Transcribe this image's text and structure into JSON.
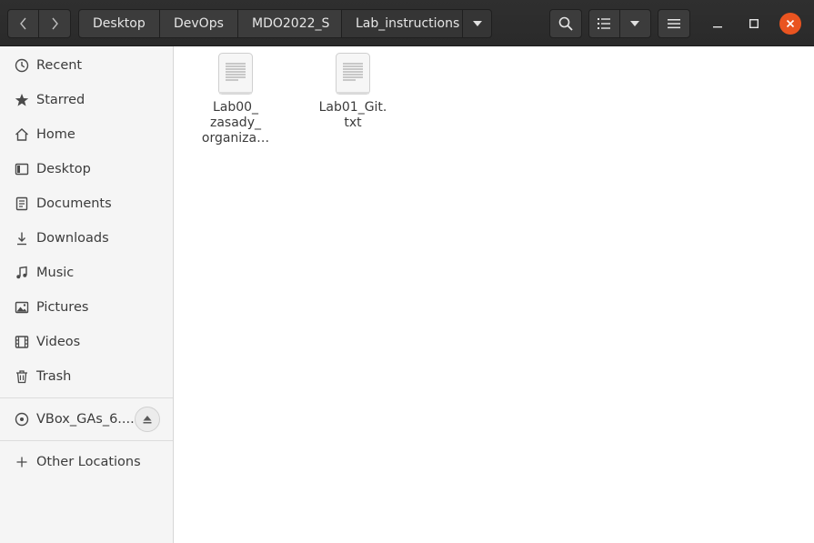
{
  "header": {
    "back_icon": "chevron-left-icon",
    "forward_icon": "chevron-right-icon",
    "breadcrumbs": [
      "Desktop",
      "DevOps",
      "MDO2022_S",
      "Lab_instructions"
    ],
    "search_icon": "search-icon",
    "view_icon": "list-view-icon",
    "view_options_icon": "chevron-down-icon",
    "menu_icon": "hamburger-menu-icon"
  },
  "window_controls": {
    "minimize": "minimize-icon",
    "maximize": "maximize-icon",
    "close": "close-icon"
  },
  "sidebar": {
    "items": [
      {
        "label": "Recent",
        "icon": "clock-icon"
      },
      {
        "label": "Starred",
        "icon": "star-icon"
      },
      {
        "label": "Home",
        "icon": "home-icon"
      },
      {
        "label": "Desktop",
        "icon": "desktop-icon"
      },
      {
        "label": "Documents",
        "icon": "document-icon"
      },
      {
        "label": "Downloads",
        "icon": "download-icon"
      },
      {
        "label": "Music",
        "icon": "music-icon"
      },
      {
        "label": "Pictures",
        "icon": "picture-icon"
      },
      {
        "label": "Videos",
        "icon": "video-icon"
      },
      {
        "label": "Trash",
        "icon": "trash-icon"
      }
    ],
    "devices": [
      {
        "label": "VBox_GAs_6....",
        "icon": "disc-icon",
        "action_icon": "eject-icon"
      }
    ],
    "other": {
      "label": "Other Locations",
      "icon": "plus-icon"
    }
  },
  "files": [
    {
      "name_lines": [
        "Lab00_",
        "zasady_",
        "organiza…"
      ],
      "icon": "text-file-icon"
    },
    {
      "name_lines": [
        "Lab01_Git.",
        "txt"
      ],
      "icon": "text-file-icon"
    }
  ],
  "colors": {
    "accent": "#e95420",
    "header": "#2c2c2c",
    "sidebar": "#f5f5f5"
  }
}
